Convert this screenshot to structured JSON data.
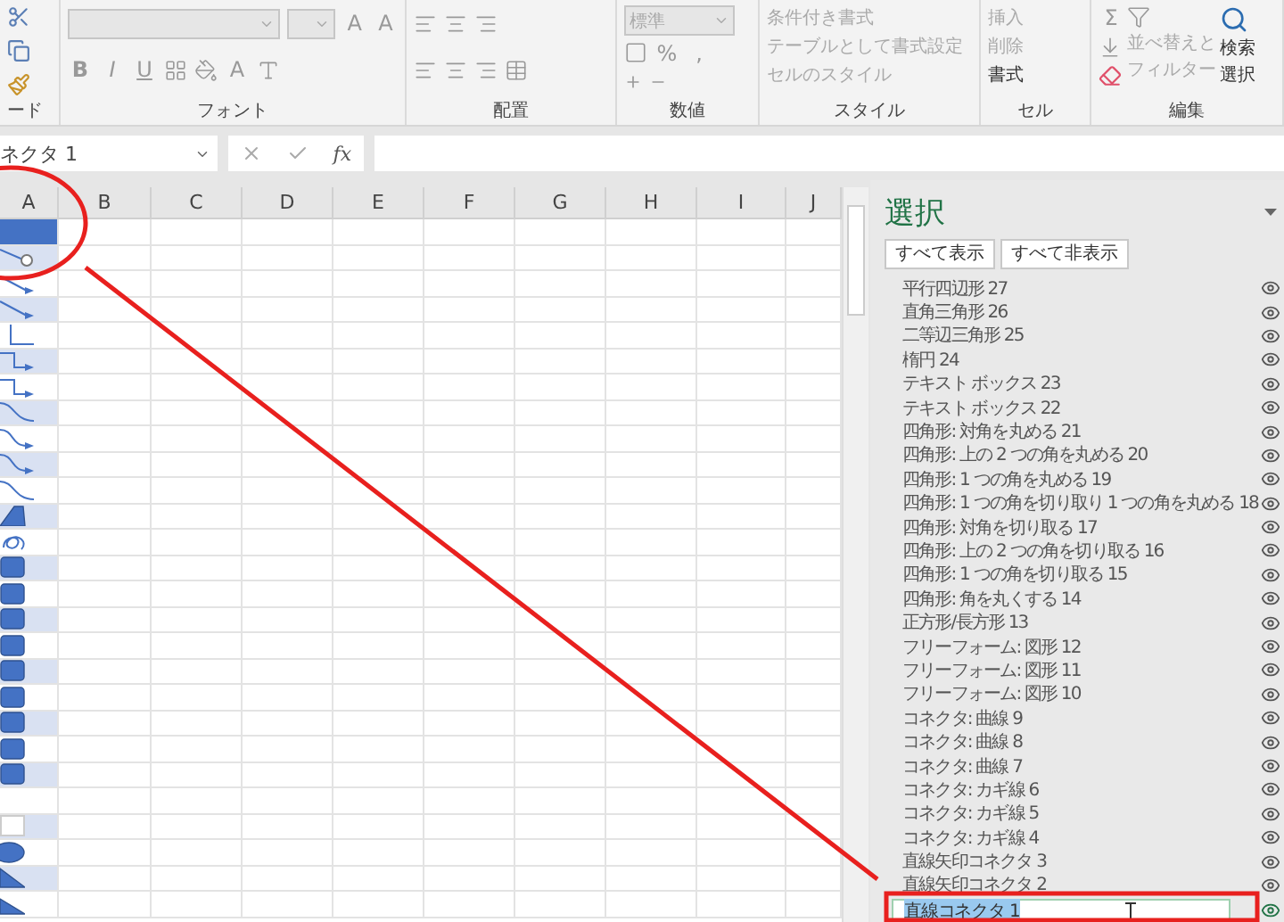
{
  "ribbon": {
    "clipboard": {
      "label": "ード"
    },
    "font": {
      "label": "フォント",
      "size_buttons": [
        "A",
        "A"
      ],
      "style_buttons": [
        "B",
        "I",
        "U"
      ],
      "color_button": "A"
    },
    "alignment": {
      "label": "配置"
    },
    "number": {
      "label": "数値",
      "format": "標準",
      "percent": "%",
      "comma": ","
    },
    "styles": {
      "label": "スタイル",
      "commands": [
        "条件付き書式",
        "テーブルとして書式設定",
        "セルのスタイル"
      ]
    },
    "cells": {
      "label": "セル",
      "commands": [
        "挿入",
        "削除",
        "書式"
      ]
    },
    "editing": {
      "label": "編集",
      "sum": "Σ",
      "sort": [
        "並べ替えと",
        "フィルター"
      ],
      "find": [
        "検索",
        "選択"
      ]
    }
  },
  "formula_bar": {
    "name_box": "ネクタ 1",
    "fx": "fx"
  },
  "sheet": {
    "columns": [
      "A",
      "B",
      "C",
      "D",
      "E",
      "F",
      "G",
      "H",
      "I",
      "J"
    ],
    "rows": [
      {
        "kind": "highlight",
        "selected": true
      },
      {
        "kind": "line-dot",
        "selected": true
      },
      {
        "kind": "arrow",
        "selected": false
      },
      {
        "kind": "arrow",
        "selected": true
      },
      {
        "kind": "elbow",
        "selected": false
      },
      {
        "kind": "elbow-arrow",
        "selected": true
      },
      {
        "kind": "elbow-arrow",
        "selected": false
      },
      {
        "kind": "curve",
        "selected": true
      },
      {
        "kind": "curve-arrow",
        "selected": false
      },
      {
        "kind": "curve-arrow",
        "selected": true
      },
      {
        "kind": "curve",
        "selected": false
      },
      {
        "kind": "trapezoid",
        "selected": true
      },
      {
        "kind": "scribble",
        "selected": false
      },
      {
        "kind": "rect",
        "selected": true
      },
      {
        "kind": "rect",
        "selected": false
      },
      {
        "kind": "rect",
        "selected": true
      },
      {
        "kind": "rect",
        "selected": false
      },
      {
        "kind": "rect",
        "selected": true
      },
      {
        "kind": "rect",
        "selected": false
      },
      {
        "kind": "rect",
        "selected": true
      },
      {
        "kind": "rect",
        "selected": false
      },
      {
        "kind": "rect",
        "selected": true
      },
      {
        "kind": "blank",
        "selected": false
      },
      {
        "kind": "textbox",
        "selected": true
      },
      {
        "kind": "ellipse",
        "selected": false
      },
      {
        "kind": "triangle",
        "selected": true
      },
      {
        "kind": "right-triangle",
        "selected": false
      }
    ]
  },
  "selection_pane": {
    "title": "選択",
    "buttons": [
      "すべて表示",
      "すべて非表示"
    ],
    "items": [
      {
        "name": "平行四辺形 27",
        "visible": true,
        "selected": false
      },
      {
        "name": "直角三角形 26",
        "visible": true,
        "selected": false
      },
      {
        "name": "二等辺三角形 25",
        "visible": true,
        "selected": false
      },
      {
        "name": "楕円 24",
        "visible": true,
        "selected": false
      },
      {
        "name": "テキスト ボックス 23",
        "visible": true,
        "selected": false
      },
      {
        "name": "テキスト ボックス 22",
        "visible": true,
        "selected": false
      },
      {
        "name": "四角形: 対角を丸める 21",
        "visible": true,
        "selected": false
      },
      {
        "name": "四角形: 上の 2 つの角を丸める 20",
        "visible": true,
        "selected": false
      },
      {
        "name": "四角形: 1 つの角を丸める 19",
        "visible": true,
        "selected": false
      },
      {
        "name": "四角形: 1 つの角を切り取り 1 つの角を丸める 18",
        "visible": true,
        "selected": false
      },
      {
        "name": "四角形: 対角を切り取る 17",
        "visible": true,
        "selected": false
      },
      {
        "name": "四角形: 上の 2 つの角を切り取る 16",
        "visible": true,
        "selected": false
      },
      {
        "name": "四角形: 1 つの角を切り取る 15",
        "visible": true,
        "selected": false
      },
      {
        "name": "四角形: 角を丸くする 14",
        "visible": true,
        "selected": false
      },
      {
        "name": "正方形/長方形 13",
        "visible": true,
        "selected": false
      },
      {
        "name": "フリーフォーム: 図形 12",
        "visible": true,
        "selected": false
      },
      {
        "name": "フリーフォーム: 図形 11",
        "visible": true,
        "selected": false
      },
      {
        "name": "フリーフォーム: 図形 10",
        "visible": true,
        "selected": false
      },
      {
        "name": "コネクタ: 曲線 9",
        "visible": true,
        "selected": false
      },
      {
        "name": "コネクタ: 曲線 8",
        "visible": true,
        "selected": false
      },
      {
        "name": "コネクタ: 曲線 7",
        "visible": true,
        "selected": false
      },
      {
        "name": "コネクタ: カギ線 6",
        "visible": true,
        "selected": false
      },
      {
        "name": "コネクタ: カギ線 5",
        "visible": true,
        "selected": false
      },
      {
        "name": "コネクタ: カギ線 4",
        "visible": true,
        "selected": false
      },
      {
        "name": "直線矢印コネクタ 3",
        "visible": true,
        "selected": false
      },
      {
        "name": "直線矢印コネクタ 2",
        "visible": true,
        "selected": false
      },
      {
        "name": "直線コネクタ 1",
        "visible": true,
        "selected": true
      }
    ]
  }
}
